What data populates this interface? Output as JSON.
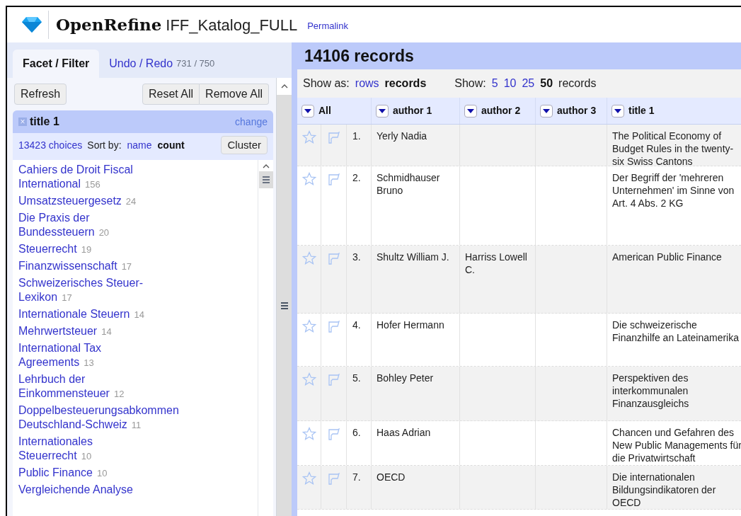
{
  "app": {
    "name": "OpenRefine",
    "project": "IFF_Katalog_FULL",
    "permalink": "Permalink"
  },
  "left_tabs": [
    {
      "label": "Facet / Filter",
      "selected": true
    },
    {
      "label": "Undo / Redo",
      "count": "731 / 750",
      "selected": false
    }
  ],
  "toolbar": {
    "refresh": "Refresh",
    "reset_all": "Reset All",
    "remove_all": "Remove All"
  },
  "facet": {
    "close": "×",
    "title": "title 1",
    "change": "change",
    "choices_count": "13423 choices",
    "sort_label": "Sort by:",
    "sort_options": [
      {
        "label": "name",
        "selected": false
      },
      {
        "label": "count",
        "selected": true
      }
    ],
    "cluster": "Cluster",
    "choices": [
      {
        "name": "Cahiers de Droit Fiscal International",
        "count": "156"
      },
      {
        "name": "Umsatzsteuergesetz",
        "count": "24"
      },
      {
        "name": "Die Praxis der Bundessteuern",
        "count": "20"
      },
      {
        "name": "Steuerrecht",
        "count": "19"
      },
      {
        "name": "Finanzwissenschaft",
        "count": "17"
      },
      {
        "name": "Schweizerisches Steuer-Lexikon",
        "count": "17"
      },
      {
        "name": "Internationale Steuern",
        "count": "14"
      },
      {
        "name": "Mehrwertsteuer",
        "count": "14"
      },
      {
        "name": "International Tax Agreements",
        "count": "13"
      },
      {
        "name": "Lehrbuch der Einkommensteuer",
        "count": "12"
      },
      {
        "name": "Doppelbesteuerungsabkommen Deutschland-Schweiz",
        "count": "11"
      },
      {
        "name": "Internationales Steuerrecht",
        "count": "10"
      },
      {
        "name": "Public Finance",
        "count": "10"
      },
      {
        "name": "Vergleichende Analyse"
      }
    ]
  },
  "summary": "14106 records",
  "view": {
    "show_as_label": "Show as:",
    "show_as": [
      {
        "label": "rows",
        "selected": false
      },
      {
        "label": "records",
        "selected": true
      }
    ],
    "show_label": "Show:",
    "page_sizes": [
      {
        "label": "5",
        "selected": false
      },
      {
        "label": "10",
        "selected": false
      },
      {
        "label": "25",
        "selected": false
      },
      {
        "label": "50",
        "selected": true
      }
    ],
    "unit": "records"
  },
  "table": {
    "all_header": "All",
    "columns": [
      "author 1",
      "author 2",
      "author 3",
      "title 1"
    ],
    "rows": [
      {
        "index": "1.",
        "cells": [
          "Yerly Nadia",
          "",
          "",
          "The Political Economy of Budget Rules in the twenty-six Swiss Cantons"
        ]
      },
      {
        "index": "2.",
        "cells": [
          "Schmidhauser Bruno",
          "",
          "",
          "Der Begriff der 'mehreren Unternehmen' im Sinne von Art. 4 Abs. 2 KG"
        ]
      },
      {
        "index": "3.",
        "cells": [
          "Shultz William J.",
          "Harriss Lowell C.",
          "",
          "American Public Finance"
        ]
      },
      {
        "index": "4.",
        "cells": [
          "Hofer Hermann",
          "",
          "",
          "Die schweizerische Finanzhilfe an Lateinamerika"
        ]
      },
      {
        "index": "5.",
        "cells": [
          "Bohley Peter",
          "",
          "",
          "Perspektiven des interkommunalen Finanzausgleichs"
        ]
      },
      {
        "index": "6.",
        "cells": [
          "Haas Adrian",
          "",
          "",
          "Chancen und Gefahren des New Public Managements für die Privatwirtschaft"
        ]
      },
      {
        "index": "7.",
        "cells": [
          "OECD",
          "",
          "",
          "Die internationalen Bildungsindikatoren der OECD"
        ]
      }
    ]
  }
}
